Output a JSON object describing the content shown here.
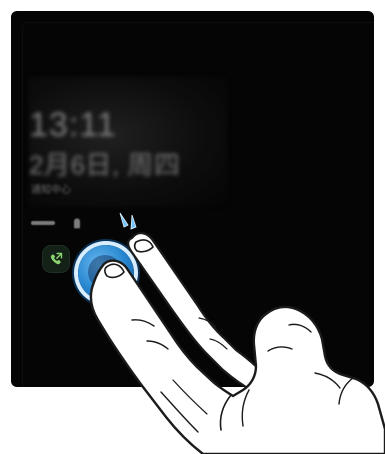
{
  "lockscreen": {
    "time": "13:11",
    "date": "2月6日, 周四",
    "substatus": "通知中心",
    "status": "",
    "call_icon": "phone-icon",
    "battery_icon": "battery-icon"
  },
  "interaction": {
    "highlighted_button": "double-tap-button",
    "tap_marks": "tap-marks-icon"
  },
  "colors": {
    "screen_bg": "#050505",
    "blurred_text": "#7f7f7f",
    "button_blue": "#2786cf",
    "button_highlight": "#d8eefe",
    "call_green": "#8ad36f"
  }
}
